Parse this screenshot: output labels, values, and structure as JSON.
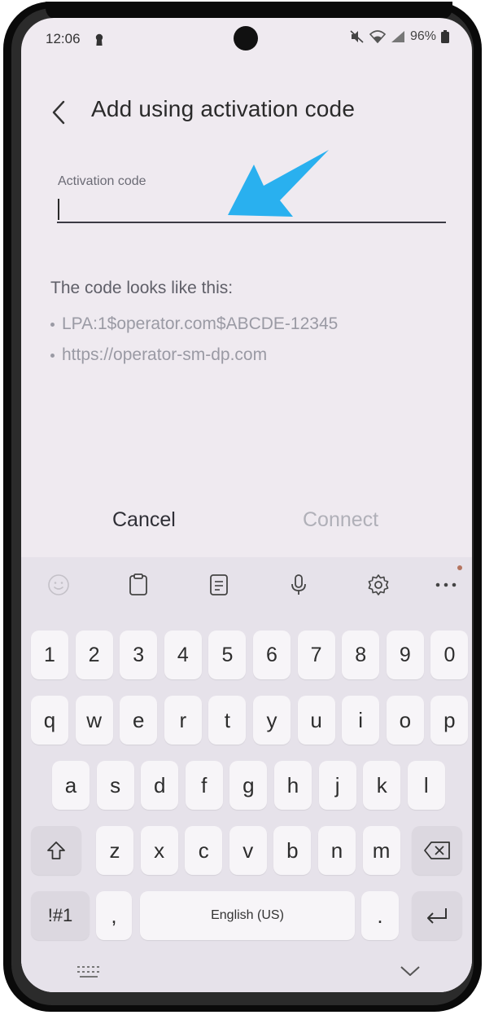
{
  "status_bar": {
    "time": "12:06",
    "battery": "96%"
  },
  "header": {
    "title": "Add using activation code"
  },
  "activation_field": {
    "label": "Activation code",
    "value": "",
    "placeholder": ""
  },
  "hint": {
    "title": "The code looks like this:",
    "examples": [
      "LPA:1$operator.com$ABCDE-12345",
      "https://operator-sm-dp.com"
    ]
  },
  "actions": {
    "cancel": "Cancel",
    "connect": "Connect"
  },
  "keyboard": {
    "toolbar_icons": [
      "emoji-icon",
      "clipboard-icon",
      "notes-icon",
      "microphone-icon",
      "settings-icon",
      "more-icon"
    ],
    "number_row": [
      "1",
      "2",
      "3",
      "4",
      "5",
      "6",
      "7",
      "8",
      "9",
      "0"
    ],
    "row1": [
      "q",
      "w",
      "e",
      "r",
      "t",
      "y",
      "u",
      "i",
      "o",
      "p"
    ],
    "row2": [
      "a",
      "s",
      "d",
      "f",
      "g",
      "h",
      "j",
      "k",
      "l"
    ],
    "row3": [
      "z",
      "x",
      "c",
      "v",
      "b",
      "n",
      "m"
    ],
    "symbols": "!#1",
    "comma": ",",
    "space": "English (US)",
    "period": "."
  },
  "colors": {
    "accent_arrow": "#29b0ef",
    "screen_bg": "#efeaf0",
    "keyboard_bg": "#e6e2ea"
  }
}
